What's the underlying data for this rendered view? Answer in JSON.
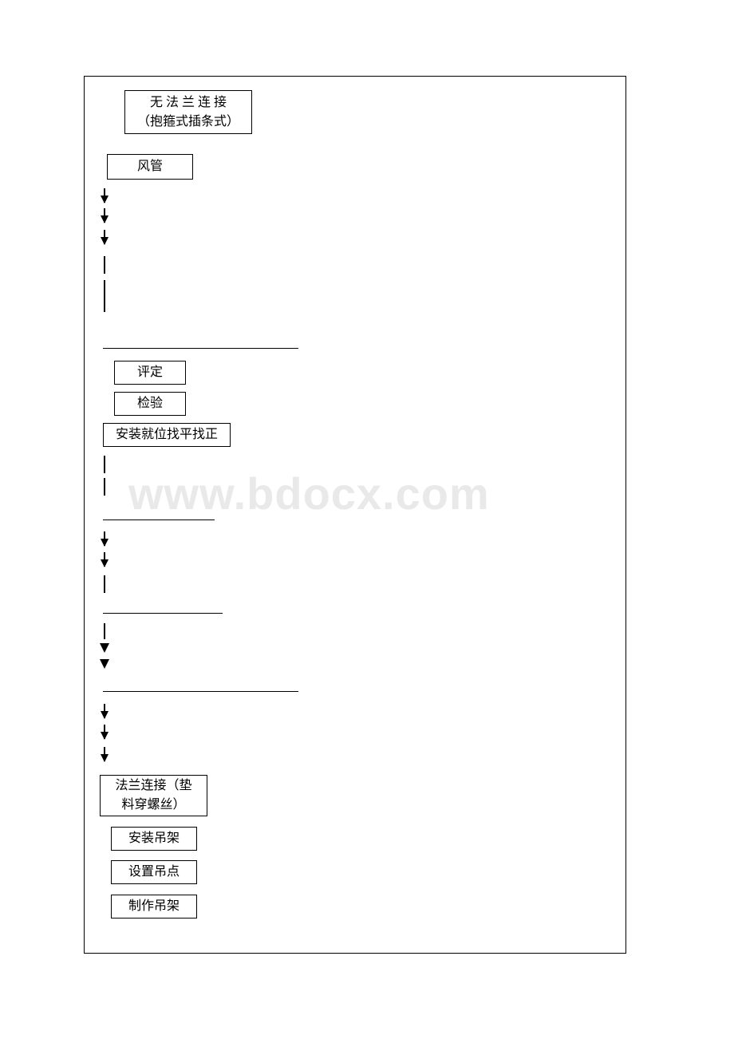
{
  "boxes": {
    "top_two_line": {
      "line1": "无 法 兰 连 接",
      "line2": "（抱箍式插条式）"
    },
    "fengguan": "风管",
    "pingding": "评定",
    "jianyan": "检验",
    "anzhuangjiuwei": "安装就位找平找正",
    "falanlianjie": {
      "line1": "法兰连接（垫",
      "line2": "料穿螺丝）"
    },
    "anzhuangdiaojia": "安装吊架",
    "shezhidiaodian": "设置吊点",
    "zhizuodiaojia": "制作吊架"
  },
  "watermark": "www.bdocx.com"
}
